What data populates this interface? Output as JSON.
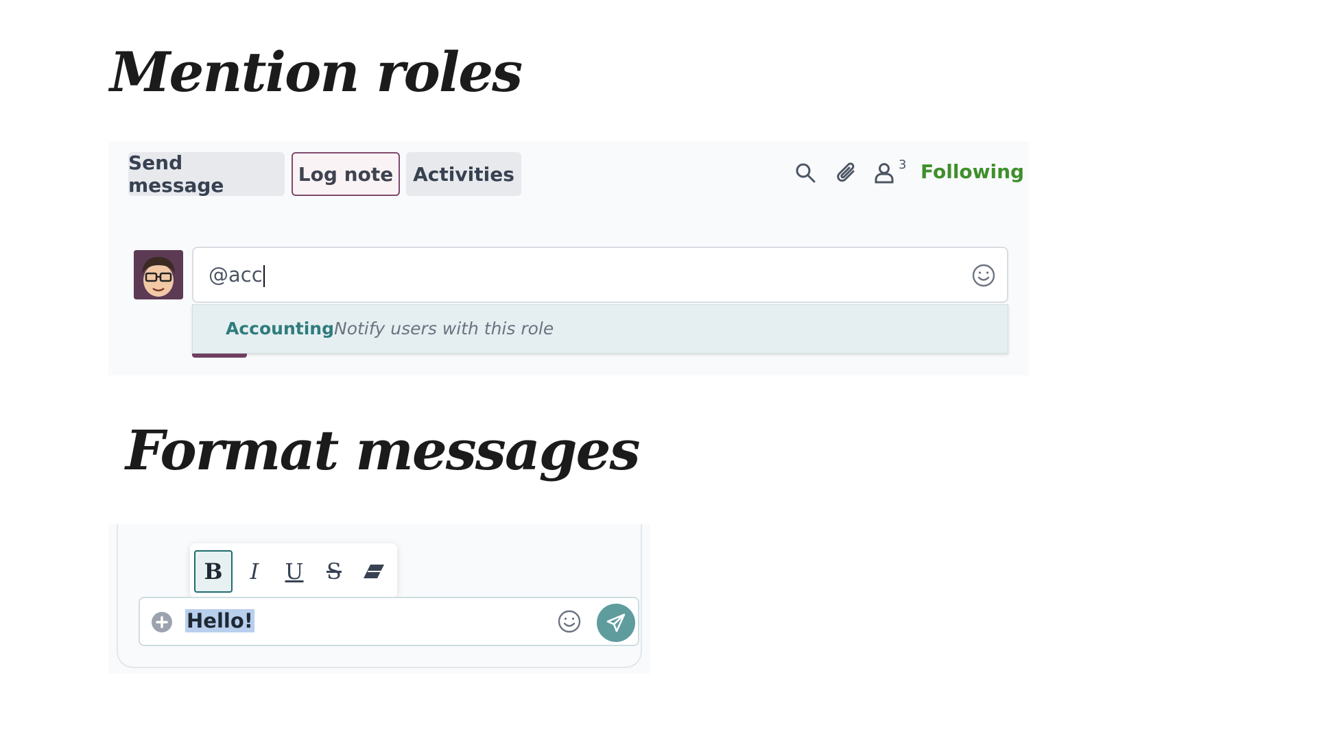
{
  "headings": {
    "mention": "Mention roles",
    "format": "Format messages"
  },
  "chatter": {
    "tabs": {
      "send_message": "Send message",
      "log_note": "Log note",
      "activities": "Activities"
    },
    "icons": [
      "search-icon",
      "paperclip-icon",
      "user-icon"
    ],
    "followers_count": "3",
    "following_label": "Following",
    "composer_value": "@acc",
    "suggestion": {
      "role": "Accounting",
      "hint": "Notify users with this role"
    },
    "colors": {
      "accent_purple": "#7e4a6a",
      "following_green": "#3f8f2c",
      "role_teal": "#2f7b7d"
    }
  },
  "format": {
    "toolbar": {
      "bold": "B",
      "italic": "I",
      "underline": "U",
      "strikethrough": "S"
    },
    "input_value": "Hello!",
    "colors": {
      "send_button": "#5f9c9e",
      "selection": "#b9cfee"
    }
  }
}
